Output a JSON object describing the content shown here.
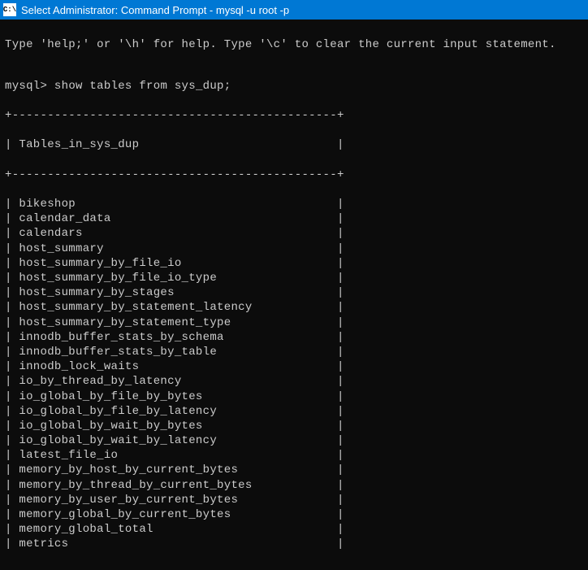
{
  "titlebar": {
    "icon_text": "C:\\",
    "title": "Select Administrator: Command Prompt - mysql  -u root -p"
  },
  "terminal": {
    "help_line": "Type 'help;' or '\\h' for help. Type '\\c' to clear the current input statement.",
    "prompt": "mysql> ",
    "command": "show tables from sys_dup;",
    "border": "+----------------------------------------------+",
    "header_prefix": "| ",
    "header_text": "Tables_in_sys_dup",
    "header_suffix": "                            |",
    "row_prefix": "| ",
    "row_suffix_pad": 45,
    "tables": [
      "bikeshop",
      "calendar_data",
      "calendars",
      "host_summary",
      "host_summary_by_file_io",
      "host_summary_by_file_io_type",
      "host_summary_by_stages",
      "host_summary_by_statement_latency",
      "host_summary_by_statement_type",
      "innodb_buffer_stats_by_schema",
      "innodb_buffer_stats_by_table",
      "innodb_lock_waits",
      "io_by_thread_by_latency",
      "io_global_by_file_by_bytes",
      "io_global_by_file_by_latency",
      "io_global_by_wait_by_bytes",
      "io_global_by_wait_by_latency",
      "latest_file_io",
      "memory_by_host_by_current_bytes",
      "memory_by_thread_by_current_bytes",
      "memory_by_user_by_current_bytes",
      "memory_global_by_current_bytes",
      "memory_global_total",
      "metrics"
    ]
  }
}
